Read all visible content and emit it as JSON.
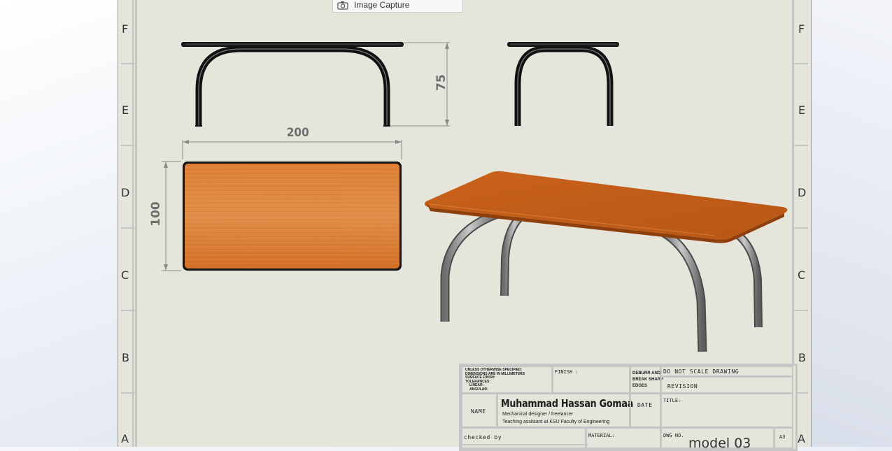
{
  "toolbar": {
    "capture_label": "Image Capture",
    "capture_icon": "camera-icon"
  },
  "zones": {
    "left": [
      "F",
      "E",
      "D",
      "C",
      "B",
      "A"
    ],
    "right": [
      "F",
      "E",
      "D",
      "C",
      "B",
      "A"
    ]
  },
  "dimensions": {
    "height": "75",
    "length": "200",
    "width": "100"
  },
  "title_block": {
    "unless_note": [
      "UNLESS OTHERWISE SPECIFIED:",
      "DIMENSIONS ARE IN MILLIMETERS",
      "SURFACE FINISH:",
      "TOLERANCES:",
      "LINEAR:",
      "ANGULAR:"
    ],
    "finish_label": "FINISH :",
    "deburr_note": [
      "DEBURR AND",
      "BREAK SHARP",
      "EDGES"
    ],
    "do_not_scale": "DO NOT SCALE DRAWING",
    "revision_label": "REVISION",
    "name_label": "NAME",
    "date_label": "DATE",
    "title_label": "TITLE:",
    "author_name": "Muhammad Hassan Gomaa",
    "author_role1": "Mechanical designer / freelancer",
    "author_role2": "Teaching assistant at KSU Faculty of Engineering",
    "checked_by": "checked by",
    "material_label": "MATERIAL:",
    "dwg_label": "DWG NO.",
    "model_name": "model 03",
    "sheet_size": "A3"
  },
  "colors": {
    "sheet": "#e6e5dc",
    "wood": "#d9762c",
    "frame": "#8a8a8a"
  }
}
